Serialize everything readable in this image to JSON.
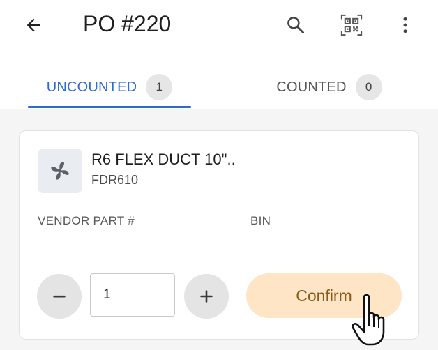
{
  "header": {
    "title": "PO #220",
    "back_icon": "arrow-left-icon",
    "search_icon": "search-icon",
    "scan_icon": "qr-scan-icon",
    "menu_icon": "more-vert-icon"
  },
  "tabs": [
    {
      "label": "UNCOUNTED",
      "count": "1",
      "active": true
    },
    {
      "label": "COUNTED",
      "count": "0",
      "active": false
    }
  ],
  "colors": {
    "accent": "#2d6bd0",
    "confirm_bg": "#fde5c5",
    "confirm_text": "#8a5a1b"
  },
  "item": {
    "name": "R6 FLEX DUCT 10\"..",
    "sku": "FDR610",
    "thumbnail_icon": "fan-icon",
    "vendor_part_label": "VENDOR PART #",
    "vendor_part_value": "",
    "bin_label": "BIN",
    "bin_value": "",
    "quantity": "1",
    "decrement_icon": "minus-icon",
    "increment_icon": "plus-icon",
    "confirm_label": "Confirm"
  }
}
